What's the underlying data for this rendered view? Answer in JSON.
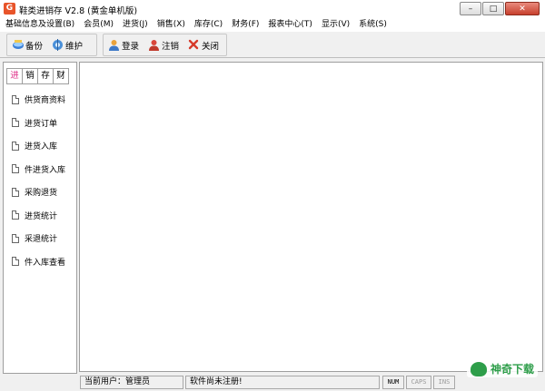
{
  "window": {
    "title": "鞋类进销存 V2.8 (黄金单机版)",
    "icon": "app-logo-icon",
    "controls": [
      "minimize-icon",
      "maximize-icon",
      "close-icon"
    ]
  },
  "menubar": {
    "items": [
      "基础信息及设置(B)",
      "会员(M)",
      "进货(J)",
      "销售(X)",
      "库存(C)",
      "财务(F)",
      "报表中心(T)",
      "显示(V)",
      "系统(S)"
    ]
  },
  "toolbar": {
    "backup": {
      "label": "备份",
      "icon": "backup-icon"
    },
    "maintain": {
      "label": "维护",
      "icon": "maintenance-icon"
    },
    "login": {
      "label": "登录",
      "icon": "login-user-icon"
    },
    "logout": {
      "label": "注销",
      "icon": "logout-user-icon"
    },
    "close": {
      "label": "关闭",
      "icon": "close-x-icon"
    }
  },
  "sidebar": {
    "tabs": [
      "进",
      "销",
      "存",
      "财"
    ],
    "active_tab": "进",
    "items": [
      "供货商资料",
      "进货订单",
      "进货入库",
      "件进货入库",
      "采购退货",
      "进货统计",
      "采退统计",
      "件入库查看"
    ]
  },
  "statusbar": {
    "current_user_label": "当前用户：",
    "current_user": "管理员",
    "registration": "软件尚未注册!",
    "keys": [
      "NUM",
      "CAPS",
      "INS"
    ]
  },
  "watermark": {
    "text": "神奇下载",
    "icon": "watermark-logo-icon"
  },
  "colors": {
    "active_tab": "#e0328a",
    "close_button": "#c7402d",
    "watermark": "#2e9e4a"
  }
}
